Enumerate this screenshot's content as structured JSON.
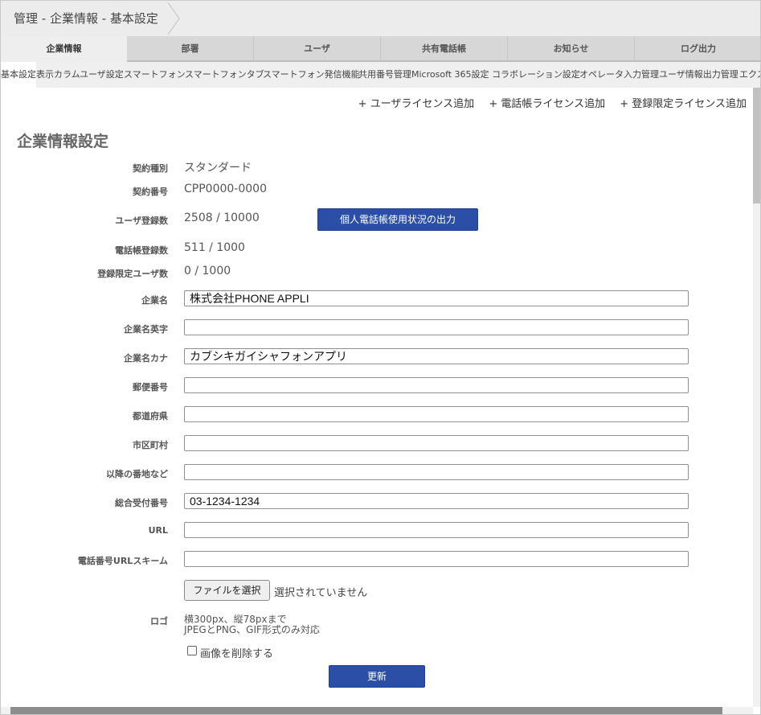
{
  "breadcrumb": {
    "text": "管理 - 企業情報 - 基本設定"
  },
  "main_tabs": [
    "企業情報",
    "部署",
    "ユーザ",
    "共有電話帳",
    "お知らせ",
    "ログ出力"
  ],
  "sub_tabs": [
    "基本設定",
    "表示カラム",
    "ユーザ設定",
    "スマートフォン",
    "スマートフォンタブ",
    "スマートフォン発信機能",
    "共用番号管理",
    "Microsoft 365設定",
    "コラボレーション設定",
    "オペレータ入力管理",
    "ユーザ情報出力管理",
    "エクスポート"
  ],
  "license_links": [
    "+ ユーザライセンス追加",
    "+ 電話帳ライセンス追加",
    "+ 登録限定ライセンス追加"
  ],
  "page_title": "企業情報設定",
  "info": {
    "contract_type": {
      "label": "契約種別",
      "value": "スタンダード"
    },
    "contract_number": {
      "label": "契約番号",
      "value": "CPP0000-0000"
    },
    "user_count": {
      "label": "ユーザ登録数",
      "value": "2508 / 10000"
    },
    "phonebook_count": {
      "label": "電話帳登録数",
      "value": "511 / 1000"
    },
    "limited_user_count": {
      "label": "登録限定ユーザ数",
      "value": "0 / 1000"
    }
  },
  "export_button": "個人電話帳使用状況の出力",
  "fields": {
    "company_name": {
      "label": "企業名",
      "value": "株式会社PHONE APPLI"
    },
    "company_name_en": {
      "label": "企業名英字",
      "value": ""
    },
    "company_name_kana": {
      "label": "企業名カナ",
      "value": "カブシキガイシャフォンアプリ"
    },
    "postal_code": {
      "label": "郵便番号",
      "value": ""
    },
    "prefecture": {
      "label": "都道府県",
      "value": ""
    },
    "city": {
      "label": "市区町村",
      "value": ""
    },
    "address": {
      "label": "以降の番地など",
      "value": ""
    },
    "main_phone": {
      "label": "総合受付番号",
      "value": "03-1234-1234"
    },
    "url": {
      "label": "URL",
      "value": ""
    },
    "url_scheme": {
      "label": "電話番号URLスキーム",
      "value": ""
    }
  },
  "logo": {
    "label": "ロゴ",
    "file_button": "ファイルを選択",
    "file_status": "選択されていません",
    "note_line1": "横300px、縦78pxまで",
    "note_line2": "JPEGとPNG、GIF形式のみ対応",
    "delete_label": "画像を削除する"
  },
  "submit_button": "更新",
  "colors": {
    "primary": "#2b4ea6",
    "tab_bg": "#d7d7d7",
    "active_tab_bg": "#eeeeee"
  }
}
